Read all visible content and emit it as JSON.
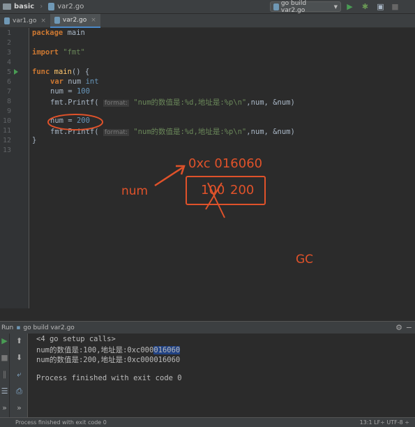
{
  "navbar": {
    "project": "basic",
    "file": "var2.go",
    "run_config": "go build var2.go"
  },
  "tabs": [
    {
      "label": "var1.go"
    },
    {
      "label": "var2.go"
    }
  ],
  "editor": {
    "line_numbers": [
      "1",
      "2",
      "3",
      "4",
      "5",
      "6",
      "7",
      "8",
      "9",
      "10",
      "11",
      "12",
      "13"
    ],
    "line1": {
      "kw": "package",
      "rest": " main"
    },
    "line3": {
      "kw": "import",
      "str": "\"fmt\""
    },
    "line5": {
      "kw": "func",
      "name": "main",
      "rest": "() {"
    },
    "line6": {
      "kw": "var",
      "rest": " num ",
      "type": "int"
    },
    "line7": {
      "rest": "num = ",
      "num": "100"
    },
    "line8": {
      "pre": "fmt.Printf( ",
      "hint": "format:",
      "str": "\"num的数值是:%d,地址是:%p\\n\"",
      "post": ",num, &num)"
    },
    "line10": {
      "rest": "num = ",
      "num": "200"
    },
    "line11": {
      "pre": "fmt.Printf( ",
      "hint": "format:",
      "str": "\"num的数值是:%d,地址是:%p\\n\"",
      "post": ",num, &num)"
    },
    "line12": "}"
  },
  "annotations": {
    "address": "0xc 016060",
    "var_label": "num",
    "old_value": "100",
    "new_value": "200",
    "gc": "GC",
    "color": "#e0522a"
  },
  "run_panel": {
    "title": "Run",
    "config": "go build var2.go",
    "lines": [
      "<4 go setup calls>",
      "num的数值是:100,地址是:0xc000",
      "016060",
      "num的数值是:200,地址是:0xc000016060",
      "Process finished with exit code 0"
    ]
  },
  "status": {
    "left": "Process finished with exit code 0",
    "right": "13:1  LF÷  UTF-8 ÷"
  }
}
